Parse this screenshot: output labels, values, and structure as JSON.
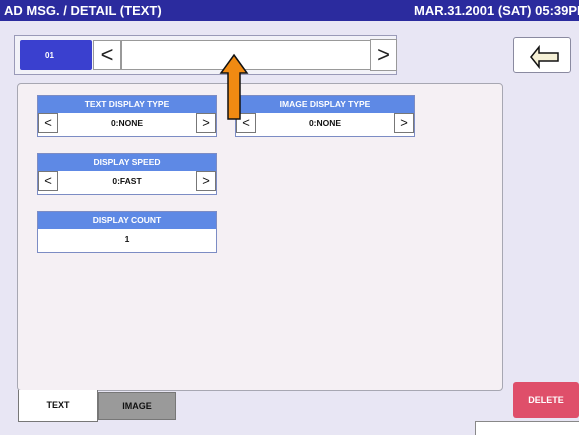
{
  "title": "AD MSG. / DETAIL (TEXT)",
  "datetime": "MAR.31.2001 (SAT) 05:39PM",
  "selector": {
    "number": "01",
    "left_glyph": "<",
    "right_glyph": ">",
    "value": ""
  },
  "text_display_type": {
    "label": "TEXT DISPLAY TYPE",
    "value": "0:NONE"
  },
  "image_display_type": {
    "label": "IMAGE DISPLAY TYPE",
    "value": "0:NONE"
  },
  "display_speed": {
    "label": "DISPLAY SPEED",
    "value": "0:FAST"
  },
  "display_count": {
    "label": "DISPLAY COUNT",
    "value": "1"
  },
  "tabs": [
    {
      "label": "TEXT",
      "active": true
    },
    {
      "label": "IMAGE",
      "active": false
    }
  ],
  "delete_label": "DELETE",
  "icons": {
    "back": "return-arrow-icon",
    "annotation": "up-arrow-icon"
  },
  "colors": {
    "titlebar": "#2b2b9e",
    "header": "#5e89e5",
    "delete": "#df4f6a",
    "annotation_arrow": "#f08a12"
  }
}
